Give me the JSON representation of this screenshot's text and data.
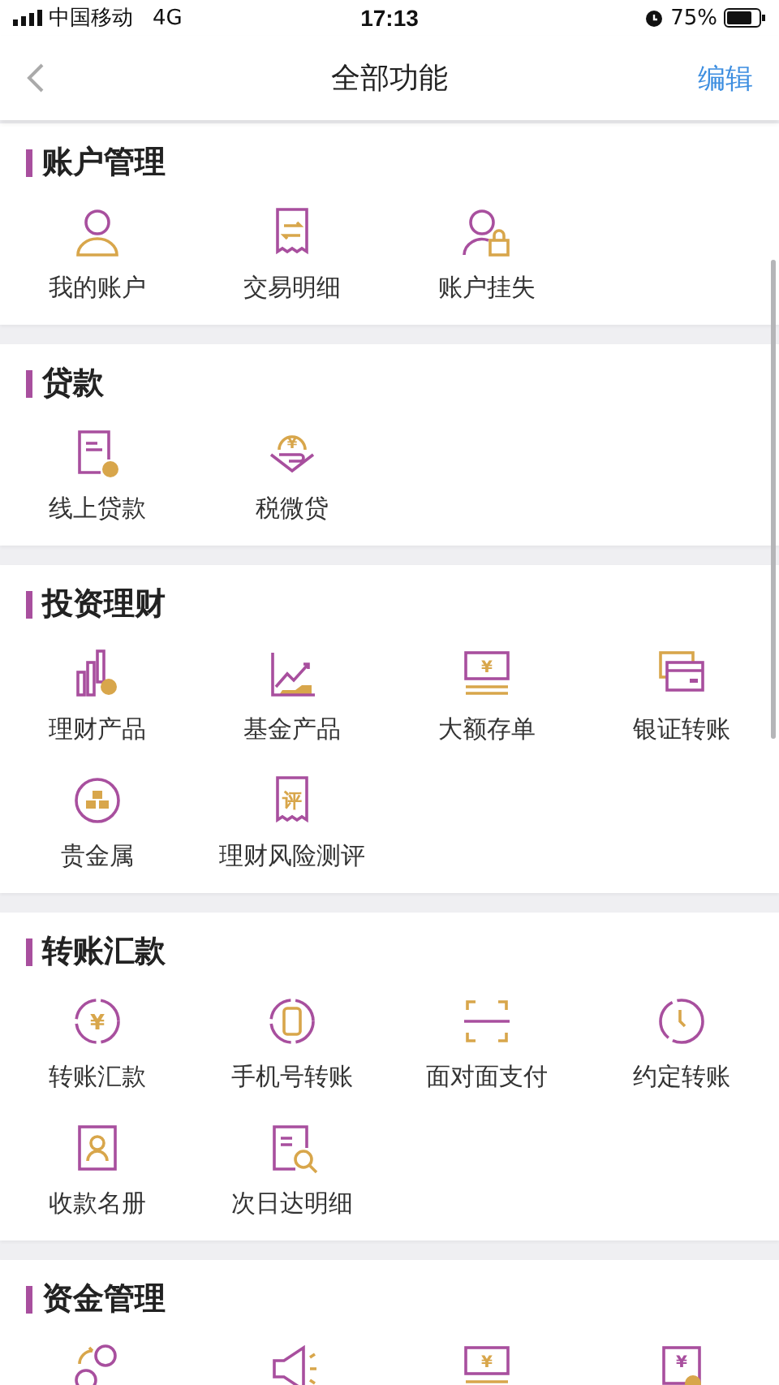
{
  "status_bar": {
    "carrier": "中国移动",
    "network": "4G",
    "time": "17:13",
    "battery": "75%"
  },
  "header": {
    "title": "全部功能",
    "action": "编辑"
  },
  "sections": [
    {
      "title": "账户管理",
      "items": [
        {
          "label": "我的账户",
          "kind": "person"
        },
        {
          "label": "交易明细",
          "kind": "receipt"
        },
        {
          "label": "账户挂失",
          "kind": "personlock"
        }
      ]
    },
    {
      "title": "贷款",
      "items": [
        {
          "label": "线上贷款",
          "kind": "document"
        },
        {
          "label": "税微贷",
          "kind": "hand",
          "glyph": "¥"
        }
      ]
    },
    {
      "title": "投资理财",
      "items": [
        {
          "label": "理财产品",
          "kind": "bars"
        },
        {
          "label": "基金产品",
          "kind": "trend"
        },
        {
          "label": "大额存单",
          "kind": "banknote",
          "glyph": "¥"
        },
        {
          "label": "银证转账",
          "kind": "card"
        },
        {
          "label": "贵金属",
          "kind": "ingot"
        },
        {
          "label": "理财风险测评",
          "kind": "receipt",
          "glyph": "评"
        }
      ]
    },
    {
      "title": "转账汇款",
      "items": [
        {
          "label": "转账汇款",
          "kind": "yen",
          "glyph": "¥"
        },
        {
          "label": "手机号转账",
          "kind": "phone"
        },
        {
          "label": "面对面支付",
          "kind": "scan"
        },
        {
          "label": "约定转账",
          "kind": "clock"
        },
        {
          "label": "收款名册",
          "kind": "contact"
        },
        {
          "label": "次日达明细",
          "kind": "search"
        }
      ]
    },
    {
      "title": "资金管理",
      "items": [
        {
          "kind": "people"
        },
        {
          "kind": "megaphone"
        },
        {
          "kind": "banknote",
          "glyph": "¥"
        },
        {
          "kind": "coin",
          "glyph": "¥"
        }
      ]
    }
  ]
}
